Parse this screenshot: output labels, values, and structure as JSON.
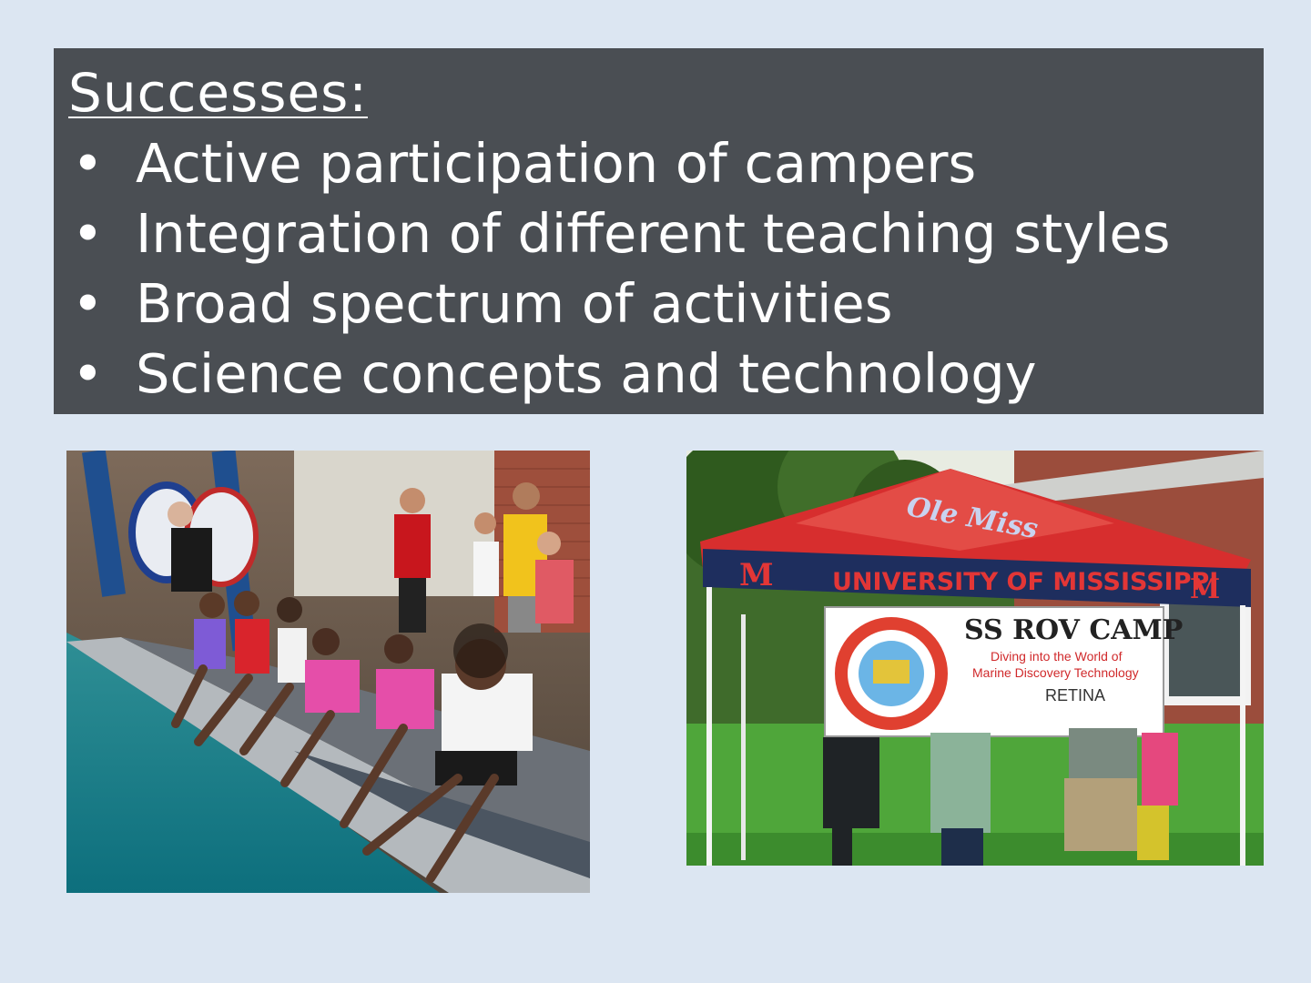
{
  "slide": {
    "title": "Successes:",
    "bullets": [
      "Active participation of campers",
      "Integration of different teaching styles",
      "Broad spectrum of activities",
      "Science concepts and technology"
    ],
    "bullet_symbol": "•"
  },
  "photos": {
    "tent": {
      "canopy_script": "Ole Miss",
      "canopy_band": "UNIVERSITY OF MISSISSIPPI",
      "canopy_logo": "M",
      "banner_title": "SS ROV CAMP",
      "banner_line1": "Diving into the World of",
      "banner_line2": "Marine Discovery Technology",
      "banner_brand": "RETINA"
    }
  },
  "colors": {
    "background": "#dce6f2",
    "text_box": "#4a4e53",
    "text": "#ffffff"
  }
}
